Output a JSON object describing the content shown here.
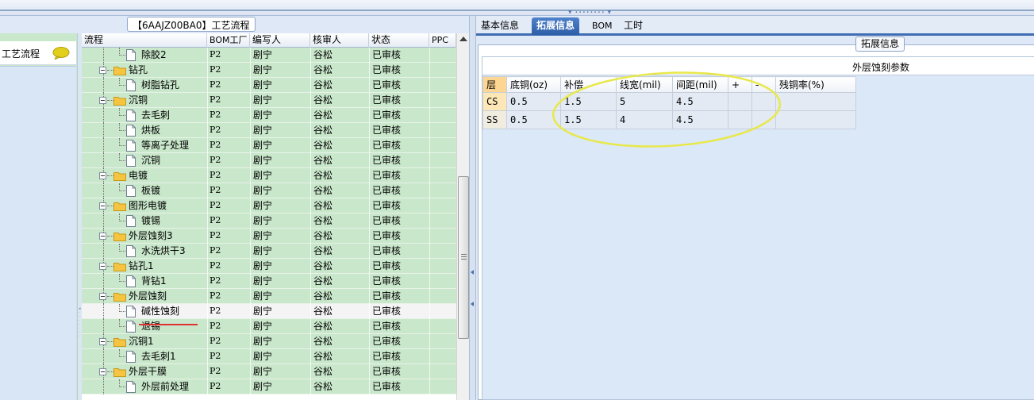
{
  "process_panel": {
    "title": "【6AAJZ00BA0】工艺流程",
    "columns": [
      "流程",
      "BOM工厂",
      "编写人",
      "核审人",
      "状态",
      "PPC"
    ]
  },
  "left_nav": {
    "item_label": "工艺流程"
  },
  "tree_rows": [
    {
      "name": "除胶2",
      "level": 1,
      "factory": "P2",
      "writer": "剧宁",
      "checker": "谷松",
      "status": "已审核"
    },
    {
      "name": "钻孔",
      "level": 0,
      "factory": "P2",
      "writer": "剧宁",
      "checker": "谷松",
      "status": "已审核"
    },
    {
      "name": "树脂钻孔",
      "level": 1,
      "factory": "P2",
      "writer": "剧宁",
      "checker": "谷松",
      "status": "已审核"
    },
    {
      "name": "沉铜",
      "level": 0,
      "factory": "P2",
      "writer": "剧宁",
      "checker": "谷松",
      "status": "已审核"
    },
    {
      "name": "去毛刺",
      "level": 1,
      "factory": "P2",
      "writer": "剧宁",
      "checker": "谷松",
      "status": "已审核"
    },
    {
      "name": "烘板",
      "level": 1,
      "factory": "P2",
      "writer": "剧宁",
      "checker": "谷松",
      "status": "已审核"
    },
    {
      "name": "等离子处理",
      "level": 1,
      "factory": "P2",
      "writer": "剧宁",
      "checker": "谷松",
      "status": "已审核"
    },
    {
      "name": "沉铜",
      "level": 1,
      "factory": "P2",
      "writer": "剧宁",
      "checker": "谷松",
      "status": "已审核"
    },
    {
      "name": "电镀",
      "level": 0,
      "factory": "P2",
      "writer": "剧宁",
      "checker": "谷松",
      "status": "已审核"
    },
    {
      "name": "板镀",
      "level": 1,
      "factory": "P2",
      "writer": "剧宁",
      "checker": "谷松",
      "status": "已审核"
    },
    {
      "name": "图形电镀",
      "level": 0,
      "factory": "P2",
      "writer": "剧宁",
      "checker": "谷松",
      "status": "已审核"
    },
    {
      "name": "镀锡",
      "level": 1,
      "factory": "P2",
      "writer": "剧宁",
      "checker": "谷松",
      "status": "已审核"
    },
    {
      "name": "外层蚀刻3",
      "level": 0,
      "factory": "P2",
      "writer": "剧宁",
      "checker": "谷松",
      "status": "已审核"
    },
    {
      "name": "水洗烘干3",
      "level": 1,
      "factory": "P2",
      "writer": "剧宁",
      "checker": "谷松",
      "status": "已审核"
    },
    {
      "name": "钻孔1",
      "level": 0,
      "factory": "P2",
      "writer": "剧宁",
      "checker": "谷松",
      "status": "已审核"
    },
    {
      "name": "背钻1",
      "level": 1,
      "factory": "P2",
      "writer": "剧宁",
      "checker": "谷松",
      "status": "已审核"
    },
    {
      "name": "外层蚀刻",
      "level": 0,
      "factory": "P2",
      "writer": "剧宁",
      "checker": "谷松",
      "status": "已审核"
    },
    {
      "name": "碱性蚀刻",
      "level": 1,
      "factory": "P2",
      "writer": "剧宁",
      "checker": "谷松",
      "status": "已审核",
      "selected": true
    },
    {
      "name": "退锡",
      "level": 1,
      "factory": "P2",
      "writer": "剧宁",
      "checker": "谷松",
      "status": "已审核"
    },
    {
      "name": "沉铜1",
      "level": 0,
      "factory": "P2",
      "writer": "剧宁",
      "checker": "谷松",
      "status": "已审核"
    },
    {
      "name": "去毛刺1",
      "level": 1,
      "factory": "P2",
      "writer": "剧宁",
      "checker": "谷松",
      "status": "已审核"
    },
    {
      "name": "外层干膜",
      "level": 0,
      "factory": "P2",
      "writer": "剧宁",
      "checker": "谷松",
      "status": "已审核"
    },
    {
      "name": "外层前处理",
      "level": 1,
      "factory": "P2",
      "writer": "剧宁",
      "checker": "谷松",
      "status": "已审核"
    }
  ],
  "right_panel": {
    "tabs": [
      "基本信息",
      "拓展信息",
      "BOM",
      "工时"
    ],
    "active_tab": 1,
    "sub_label": "拓展信息",
    "section_title": "外层蚀刻参数",
    "table_headers": [
      "层",
      "底铜(oz)",
      "补偿",
      "线宽(mil)",
      "间距(mil)",
      "+",
      "-",
      "残铜率(%)"
    ],
    "table_rows": [
      [
        "CS",
        "0.5",
        "1.5",
        "5",
        "4.5",
        "",
        "",
        ""
      ],
      [
        "SS",
        "0.5",
        "1.5",
        "4",
        "4.5",
        "",
        "",
        ""
      ]
    ]
  },
  "colors": {
    "row_green": "#c9e7cb",
    "tab_active": "#2d5ea8",
    "highlight_ellipse": "#e8e84a",
    "red_underline": "#e03030"
  },
  "icons": [
    "speech-bubble-icon",
    "folder-icon",
    "document-icon",
    "expander-minus-icon"
  ]
}
